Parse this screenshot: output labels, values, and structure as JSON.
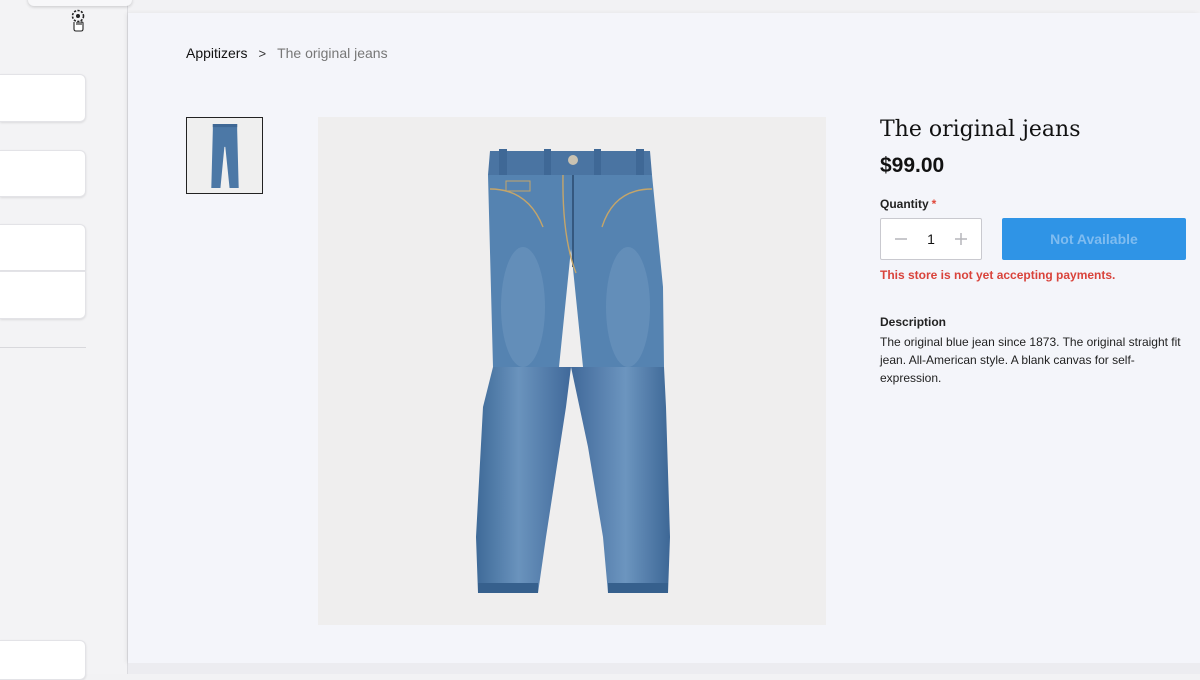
{
  "breadcrumb": {
    "parent": "Appitizers",
    "separator": ">",
    "current": "The original jeans"
  },
  "product": {
    "title": "The original jeans",
    "price": "$99.00",
    "quantity_label": "Quantity",
    "required_mark": "*",
    "quantity_value": "1",
    "buy_button_label": "Not Available",
    "payment_error": "This store is not yet accepting payments.",
    "description_heading": "Description",
    "description": "The original blue jean since 1873. The original straight fit jean. All-American style. A blank canvas for self-expression."
  },
  "icons": {
    "decrement": "minus-icon",
    "increment": "plus-icon",
    "cursor": "gear-cursor-icon"
  },
  "colors": {
    "accent": "#2f94e6",
    "error": "#d9433b",
    "required": "#e0483b",
    "denim": "#4c78a6"
  }
}
